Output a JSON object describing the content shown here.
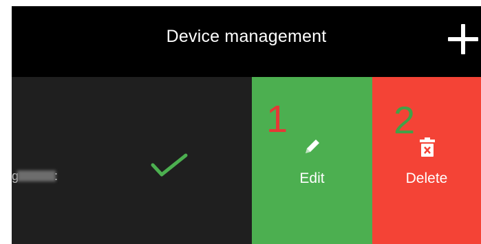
{
  "header": {
    "title": "Device management",
    "add_icon": "plus-icon"
  },
  "device": {
    "name_leading": "g",
    "name_trailing": ":",
    "status_icon": "check-icon"
  },
  "actions": {
    "edit": {
      "label": "Edit",
      "icon": "pencil-icon",
      "color": "#4caf50"
    },
    "delete": {
      "label": "Delete",
      "icon": "trash-icon",
      "color": "#f44336"
    }
  },
  "annotations": {
    "marker_1": "1",
    "marker_2": "2"
  },
  "colors": {
    "header_bg": "#000000",
    "row_bg": "#1f1f1f",
    "check": "#4caf50",
    "marker_1": "#e53935",
    "marker_2": "#43a047"
  }
}
